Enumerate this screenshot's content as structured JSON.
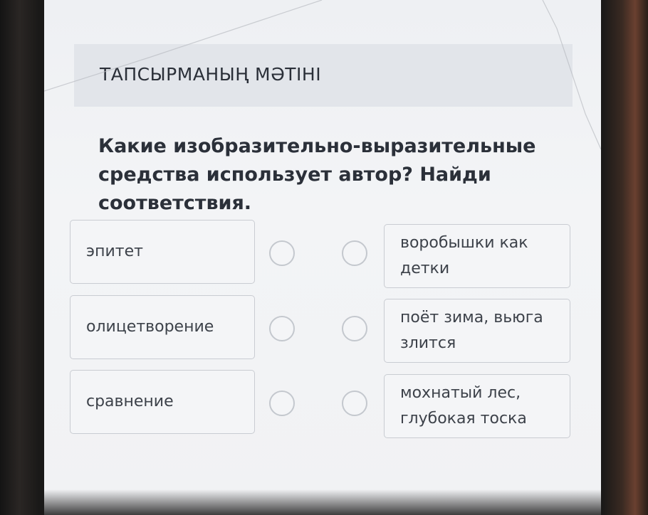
{
  "header": {
    "title": "ТАПСЫРМАНЫҢ МӘТІНІ"
  },
  "question": {
    "text": "Какие изобразительно-выразительные средства использует автор? Найди соответствия."
  },
  "left_items": [
    {
      "label": "эпитет"
    },
    {
      "label": "олицетворение"
    },
    {
      "label": "сравнение"
    }
  ],
  "right_items": [
    {
      "label": "воробышки как детки"
    },
    {
      "label": "поёт зима, вьюга злится"
    },
    {
      "label": "мохнатый лес, глубокая тоска"
    }
  ]
}
